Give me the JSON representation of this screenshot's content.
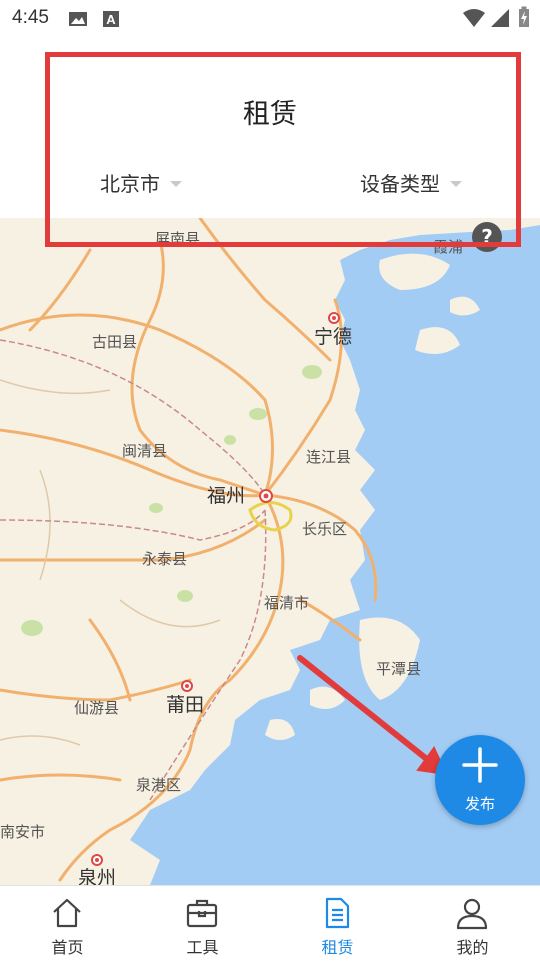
{
  "status_bar": {
    "time": "4:45"
  },
  "header": {
    "title": "租赁",
    "city_filter": "北京市",
    "type_filter": "设备类型"
  },
  "map": {
    "help_label": "?",
    "places": {
      "pingnan": "屏南县",
      "ningde": "宁德",
      "gutian": "古田县",
      "minqing": "闽清县",
      "lianjiang": "连江县",
      "fuzhou": "福州",
      "changle": "长乐区",
      "yongtai": "永泰县",
      "fuqing": "福清市",
      "pingtan": "平潭县",
      "putian": "莆田",
      "xianyou": "仙游县",
      "quangang": "泉港区",
      "nanan": "南安市",
      "quanzhou": "泉州",
      "xiapu": "霞浦"
    }
  },
  "fab": {
    "label": "发布",
    "icon": "plus-icon"
  },
  "tabs": [
    {
      "label": "首页",
      "icon": "home-icon"
    },
    {
      "label": "工具",
      "icon": "toolbox-icon"
    },
    {
      "label": "租赁",
      "icon": "document-icon",
      "active": true
    },
    {
      "label": "我的",
      "icon": "user-icon"
    }
  ],
  "colors": {
    "accent": "#1e8ae6",
    "highlight_box": "#e23b3b",
    "sea": "#a3ccf5",
    "land": "#f7f1e4",
    "road": "#f2b06d"
  }
}
